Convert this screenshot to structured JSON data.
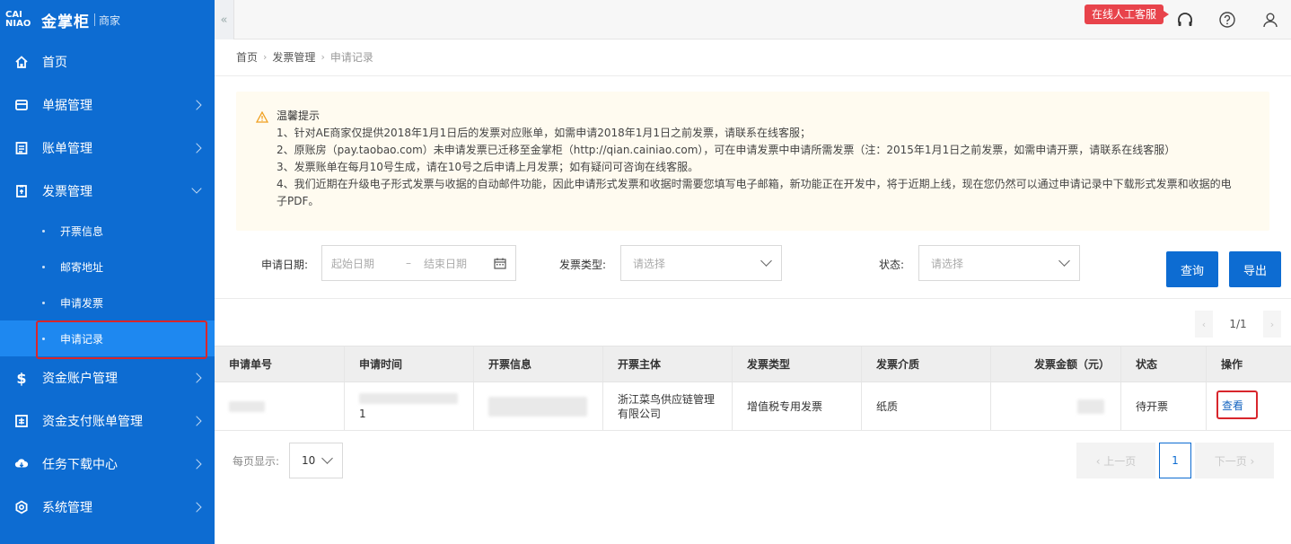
{
  "brand": {
    "logo_text": "CAINIAO",
    "name": "金掌柜",
    "sub": "商家"
  },
  "sidebar": {
    "items": [
      {
        "label": "首页",
        "icon": "home-icon"
      },
      {
        "label": "单据管理",
        "icon": "document-icon"
      },
      {
        "label": "账单管理",
        "icon": "bill-icon"
      },
      {
        "label": "发票管理",
        "icon": "invoice-icon",
        "expanded": true
      },
      {
        "label": "资金账户管理",
        "icon": "dollar-icon"
      },
      {
        "label": "资金支付账单管理",
        "icon": "payment-icon"
      },
      {
        "label": "任务下载中心",
        "icon": "cloud-download-icon"
      },
      {
        "label": "系统管理",
        "icon": "settings-icon"
      }
    ],
    "sub_items": [
      {
        "label": "开票信息"
      },
      {
        "label": "邮寄地址"
      },
      {
        "label": "申请发票"
      },
      {
        "label": "申请记录",
        "active": true
      }
    ]
  },
  "topbar": {
    "collapse": "«",
    "service_label": "在线人工客服"
  },
  "breadcrumb": [
    "首页",
    "发票管理",
    "申请记录"
  ],
  "notice": {
    "title": "温馨提示",
    "lines": [
      "1、针对AE商家仅提供2018年1月1日后的发票对应账单，如需申请2018年1月1日之前发票，请联系在线客服；",
      "2、原账房（pay.taobao.com）未申请发票已迁移至金掌柜（http://qian.cainiao.com），可在申请发票中申请所需发票（注：2015年1月1日之前发票，如需申请开票，请联系在线客服）",
      "3、发票账单在每月10号生成，请在10号之后申请上月发票；如有疑问可咨询在线客服。",
      "4、我们近期在升级电子形式发票与收据的自动邮件功能，因此申请形式发票和收据时需要您填写电子邮箱，新功能正在开发中，将于近期上线，现在您仍然可以通过申请记录中下载形式发票和收据的电",
      "子PDF。"
    ]
  },
  "filters": {
    "date_label": "申请日期:",
    "start_placeholder": "起始日期",
    "date_sep": "–",
    "end_placeholder": "结束日期",
    "type_label": "发票类型:",
    "type_placeholder": "请选择",
    "status_label": "状态:",
    "status_placeholder": "请选择",
    "query_label": "查询",
    "export_label": "导出"
  },
  "pager_top": {
    "text": "1/1",
    "prev": "‹",
    "next": "›"
  },
  "table": {
    "columns": [
      "申请单号",
      "申请时间",
      "开票信息",
      "开票主体",
      "发票类型",
      "发票介质",
      "发票金额（元）",
      "状态",
      "操作"
    ],
    "rows": [
      {
        "time_tail": "1",
        "subject": "浙江菜鸟供应链管理有限公司",
        "type": "增值税专用发票",
        "medium": "纸质",
        "status": "待开票",
        "action": "查看"
      }
    ]
  },
  "footer": {
    "page_size_label": "每页显示:",
    "page_size": "10",
    "prev_label": "‹  上一页",
    "current_page": "1",
    "next_label": "下一页  ›"
  },
  "colors": {
    "sidebar": "#0d6cd2",
    "active_sub": "#1e88f0",
    "primary": "#0d6cd2",
    "highlight": "#d8262c",
    "service": "#e8434b"
  }
}
